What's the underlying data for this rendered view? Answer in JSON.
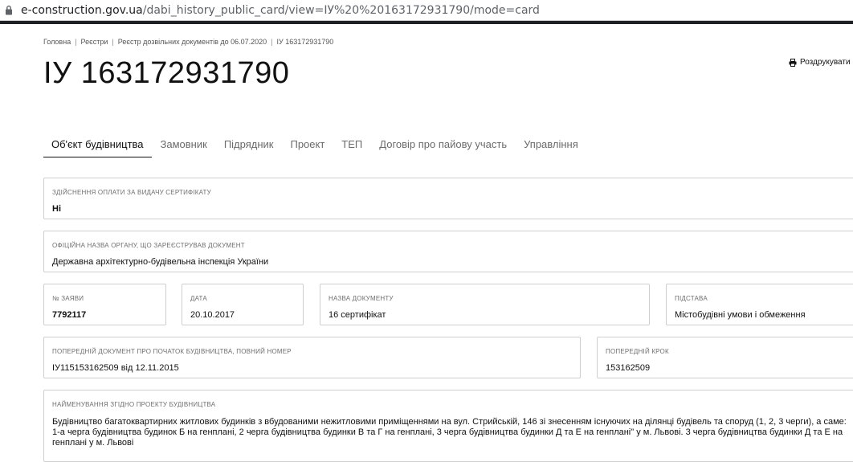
{
  "browser": {
    "url_domain": "e-construction.gov.ua",
    "url_path": "/dabi_history_public_card/view=ІУ%20%20163172931790/mode=card"
  },
  "breadcrumb": [
    "Головна",
    "Реєстри",
    "Реєстр дозвільних документів до 06.07.2020",
    "ІУ 163172931790"
  ],
  "title": "ІУ 163172931790",
  "print_label": "Роздрукувати",
  "tabs": [
    "Об'єкт будівництва",
    "Замовник",
    "Підрядник",
    "Проект",
    "ТЕП",
    "Договір про пайову участь",
    "Управління"
  ],
  "fields": {
    "payment": {
      "label": "Здійснення оплати за видачу сертифікату",
      "value": "Ні"
    },
    "authority": {
      "label": "Офіційна назва органу, що зареєстрував документ",
      "value": "Державна архітектурно-будівельна інспекція України"
    },
    "application_no": {
      "label": "№ заяви",
      "value": "7792117"
    },
    "date": {
      "label": "Дата",
      "value": "20.10.2017"
    },
    "doc_name": {
      "label": "Назва документу",
      "value": "16 сертифікат"
    },
    "basis": {
      "label": "Підстава",
      "value": "Містобудівні умови і обмеження"
    },
    "prev_doc": {
      "label": "Попередній документ про початок будівництва, повний номер",
      "value": "ІУ115153162509 від 12.11.2015"
    },
    "prev_step": {
      "label": "Попередній крок",
      "value": "153162509"
    },
    "project_name": {
      "label": "Найменування згідно проекту будівництва",
      "value": "Будівництво багатоквартирних житлових будинків з вбудованими нежитловими приміщеннями на вул. Стрийській, 146 зі знесенням існуючих на ділянці будівель та споруд (1, 2, 3 черги), а саме: 1-а черга будівництва будинок Б на генплані, 2 черга будівництва будинки В та Г на генплані, 3 черга будівництва будинки Д та Е на генплані\" у м. Львові. 3 черга будівництва будинки Д та Е на генплані у м. Львові"
    }
  }
}
